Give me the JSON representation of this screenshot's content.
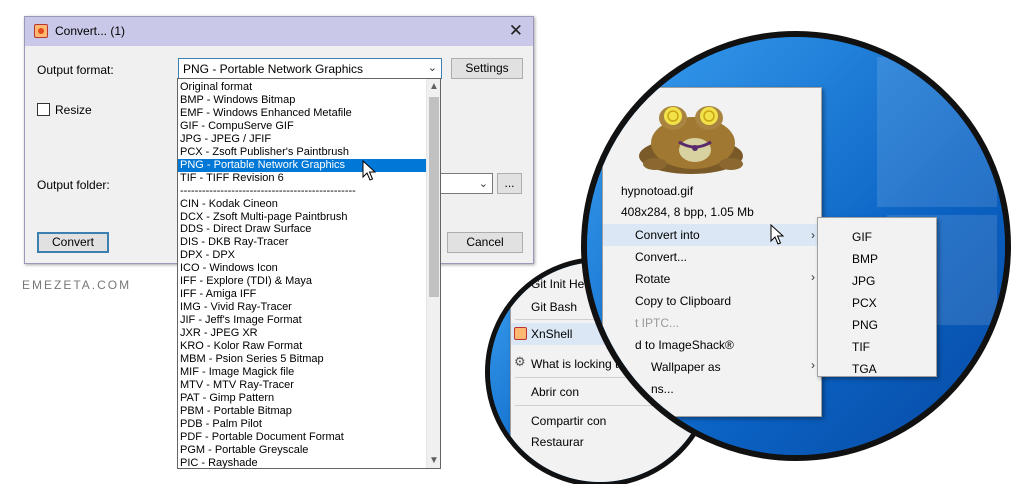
{
  "dialog": {
    "title": "Convert... (1)",
    "close_glyph": "✕",
    "output_format_label": "Output format:",
    "selected_format": "PNG - Portable Network Graphics",
    "settings_label": "Settings",
    "resize_label": "Resize",
    "output_folder_label": "Output folder:",
    "browse_label": "...",
    "convert_label": "Convert",
    "cancel_label": "Cancel"
  },
  "dropdown": {
    "options": [
      "Original format",
      "BMP - Windows Bitmap",
      "EMF - Windows Enhanced Metafile",
      "GIF - CompuServe GIF",
      "JPG - JPEG / JFIF",
      "PCX - Zsoft Publisher's Paintbrush",
      "PNG - Portable Network Graphics",
      "TIF - TIFF Revision 6",
      "------------------------------------------------",
      "CIN - Kodak Cineon",
      "DCX - Zsoft Multi-page Paintbrush",
      "DDS - Direct Draw Surface",
      "DIS - DKB Ray-Tracer",
      "DPX - DPX",
      "ICO - Windows Icon",
      "IFF - Explore (TDI) & Maya",
      "IFF - Amiga IFF",
      "IMG - Vivid Ray-Tracer",
      "JIF - Jeff's Image Format",
      "JXR - JPEG XR",
      "KRO - Kolor Raw Format",
      "MBM - Psion Series 5 Bitmap",
      "MIF - Image Magick file",
      "MTV - MTV Ray-Tracer",
      "PAT - Gimp Pattern",
      "PBM - Portable Bitmap",
      "PDB - Palm Pilot",
      "PDF - Portable Document Format",
      "PGM - Portable Greyscale",
      "PIC - Rayshade"
    ],
    "selected_index": 6
  },
  "brand": "EMEZETA.COM",
  "small_menu": {
    "items": [
      "Git Init Here",
      "Git Bash",
      "XnShell",
      "What is locking this fil",
      "Abrir con",
      "Compartir con",
      "Restaurar"
    ]
  },
  "big_menu": {
    "file_name": "hypnotoad.gif",
    "file_info": "408x284, 8 bpp, 1.05 Mb",
    "items": [
      "Convert into",
      "Convert...",
      "Rotate",
      "Copy to Clipboard",
      "t IPTC...",
      "d to ImageShack®",
      "Wallpaper as",
      "ns..."
    ],
    "submenu": [
      "GIF",
      "BMP",
      "JPG",
      "PCX",
      "PNG",
      "TIF",
      "TGA"
    ]
  },
  "colors": {
    "title_bar": "#c9c8e8",
    "selection": "#0078d7",
    "focus_border": "#3c7fb1",
    "desktop_blue": "#0e5fb8"
  }
}
